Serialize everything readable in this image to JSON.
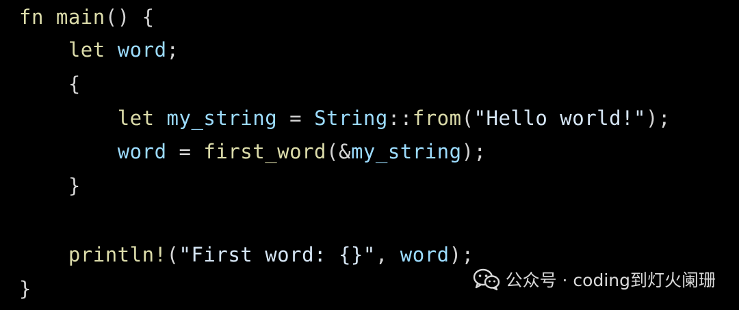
{
  "editor": {
    "lines": [
      {
        "indent": "",
        "tokens": [
          {
            "t": "fn",
            "k": "kw"
          },
          {
            "t": " ",
            "k": "punct"
          },
          {
            "t": "main",
            "k": "fn"
          },
          {
            "t": "() {",
            "k": "punct"
          }
        ]
      },
      {
        "indent": "    ",
        "tokens": [
          {
            "t": "let",
            "k": "kw"
          },
          {
            "t": " ",
            "k": "punct"
          },
          {
            "t": "word",
            "k": "var"
          },
          {
            "t": ";",
            "k": "punct"
          }
        ]
      },
      {
        "indent": "    ",
        "tokens": [
          {
            "t": "{",
            "k": "punct"
          }
        ]
      },
      {
        "indent": "        ",
        "tokens": [
          {
            "t": "let",
            "k": "kw"
          },
          {
            "t": " ",
            "k": "punct"
          },
          {
            "t": "my_string",
            "k": "var"
          },
          {
            "t": " = ",
            "k": "op"
          },
          {
            "t": "String",
            "k": "type"
          },
          {
            "t": "::",
            "k": "punct"
          },
          {
            "t": "from",
            "k": "fn"
          },
          {
            "t": "(",
            "k": "punct"
          },
          {
            "t": "\"Hello world!\"",
            "k": "str"
          },
          {
            "t": ");",
            "k": "punct"
          }
        ]
      },
      {
        "indent": "        ",
        "tokens": [
          {
            "t": "word",
            "k": "var"
          },
          {
            "t": " = ",
            "k": "op"
          },
          {
            "t": "first_word",
            "k": "fn"
          },
          {
            "t": "(&",
            "k": "punct"
          },
          {
            "t": "my_string",
            "k": "var"
          },
          {
            "t": ");",
            "k": "punct"
          }
        ]
      },
      {
        "indent": "    ",
        "tokens": [
          {
            "t": "}",
            "k": "punct"
          }
        ]
      },
      {
        "indent": "",
        "tokens": []
      },
      {
        "indent": "    ",
        "tokens": [
          {
            "t": "println!",
            "k": "fn"
          },
          {
            "t": "(",
            "k": "punct"
          },
          {
            "t": "\"First word: {}\"",
            "k": "str"
          },
          {
            "t": ", ",
            "k": "punct"
          },
          {
            "t": "word",
            "k": "var"
          },
          {
            "t": ");",
            "k": "punct"
          }
        ]
      },
      {
        "indent": "",
        "tokens": [
          {
            "t": "}",
            "k": "punct"
          }
        ]
      }
    ]
  },
  "watermark": {
    "icon": "wechat-icon",
    "text": "公众号 · coding到灯火阑珊"
  },
  "colors": {
    "background": "#000000",
    "keyword": "#dcdcaa",
    "identifier": "#9cdcfe",
    "punctuation": "#d4d4d4",
    "string": "#d6e6f5"
  }
}
